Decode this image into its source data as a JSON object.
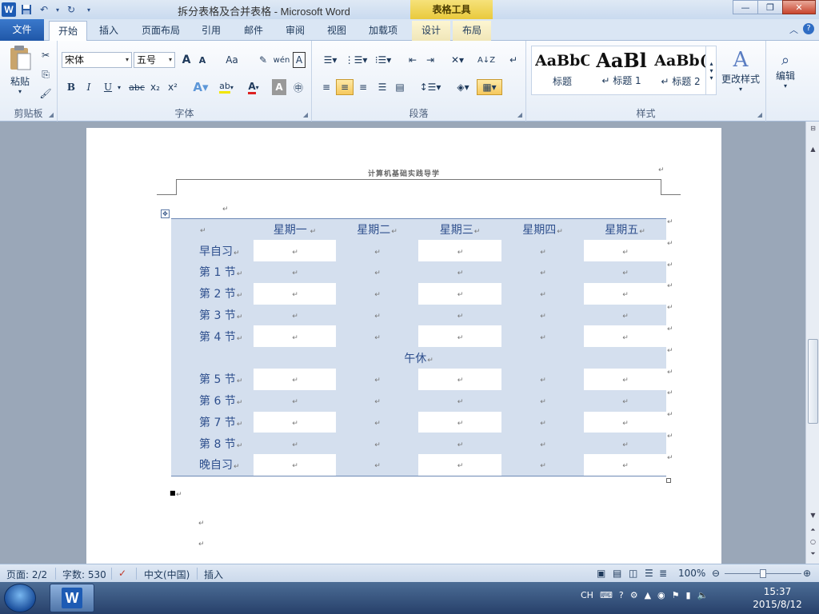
{
  "titlebar": {
    "title": "拆分表格及合并表格 - Microsoft Word",
    "context_tab_group": "表格工具",
    "app_logo": "W",
    "qat_icons": [
      "word-icon",
      "save-icon",
      "undo-icon",
      "redo-icon",
      "customize-icon"
    ]
  },
  "tabs": {
    "file": "文件",
    "home": "开始",
    "insert": "插入",
    "page_layout": "页面布局",
    "references": "引用",
    "mailings": "邮件",
    "review": "审阅",
    "view": "视图",
    "addins": "加载项",
    "design": "设计",
    "layout": "布局"
  },
  "ribbon": {
    "clipboard": {
      "label": "剪贴板",
      "paste": "粘贴"
    },
    "font": {
      "label": "字体",
      "font_name": "宋体",
      "font_size": "五号",
      "grow": "A",
      "shrink": "A",
      "change_case": "Aa",
      "bold": "B",
      "italic": "I",
      "underline": "U",
      "strikethrough": "abc",
      "subscript": "x₂",
      "superscript": "x²"
    },
    "paragraph": {
      "label": "段落"
    },
    "styles": {
      "label": "样式",
      "items": [
        {
          "sample": "AaBbC",
          "name": "标题"
        },
        {
          "sample": "AaBl",
          "name": "↵ 标题 1"
        },
        {
          "sample": "AaBb(",
          "name": "↵ 标题 2"
        }
      ],
      "change_styles": "更改样式"
    },
    "editing": {
      "label": "编辑"
    }
  },
  "document": {
    "header_text": "计算机基础实践导学",
    "table": {
      "day_headers": [
        "星期一",
        "星期二",
        "星期三",
        "星期四",
        "星期五"
      ],
      "rows_before_lunch": [
        "早自习",
        "第 1 节",
        "第 2 节",
        "第 3 节",
        "第 4 节"
      ],
      "lunch": "午休",
      "rows_after_lunch": [
        "第 5 节",
        "第 6 节",
        "第 7 节",
        "第 8 节",
        "晚自习"
      ]
    }
  },
  "statusbar": {
    "page": "页面: 2/2",
    "words": "字数: 530",
    "language": "中文(中国)",
    "mode": "插入",
    "zoom": "100%",
    "zoom_level": 1.0
  },
  "taskbar": {
    "ime": "CH",
    "time": "15:37",
    "date": "2015/8/12"
  },
  "colors": {
    "table_band": "#d4dfee",
    "table_text": "#2e4f8d",
    "file_tab": "#1f57a8",
    "context_tab": "#e9c93c"
  }
}
